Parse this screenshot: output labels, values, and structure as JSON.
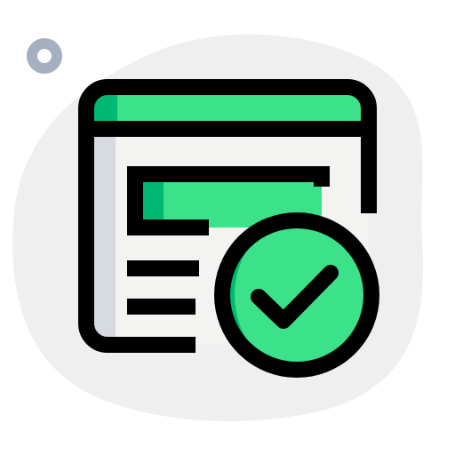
{
  "icon": {
    "name": "verified-web-page-icon",
    "description_visible_text": "",
    "colors": {
      "background_blob": "#efefef",
      "dot_ring": "#a4afc1",
      "accent_green": "#3be28a",
      "shade_green": "#00b871",
      "page_fill": "#f3f3f1",
      "page_side_shade": "#d5dbe1",
      "outline": "#000000"
    }
  }
}
